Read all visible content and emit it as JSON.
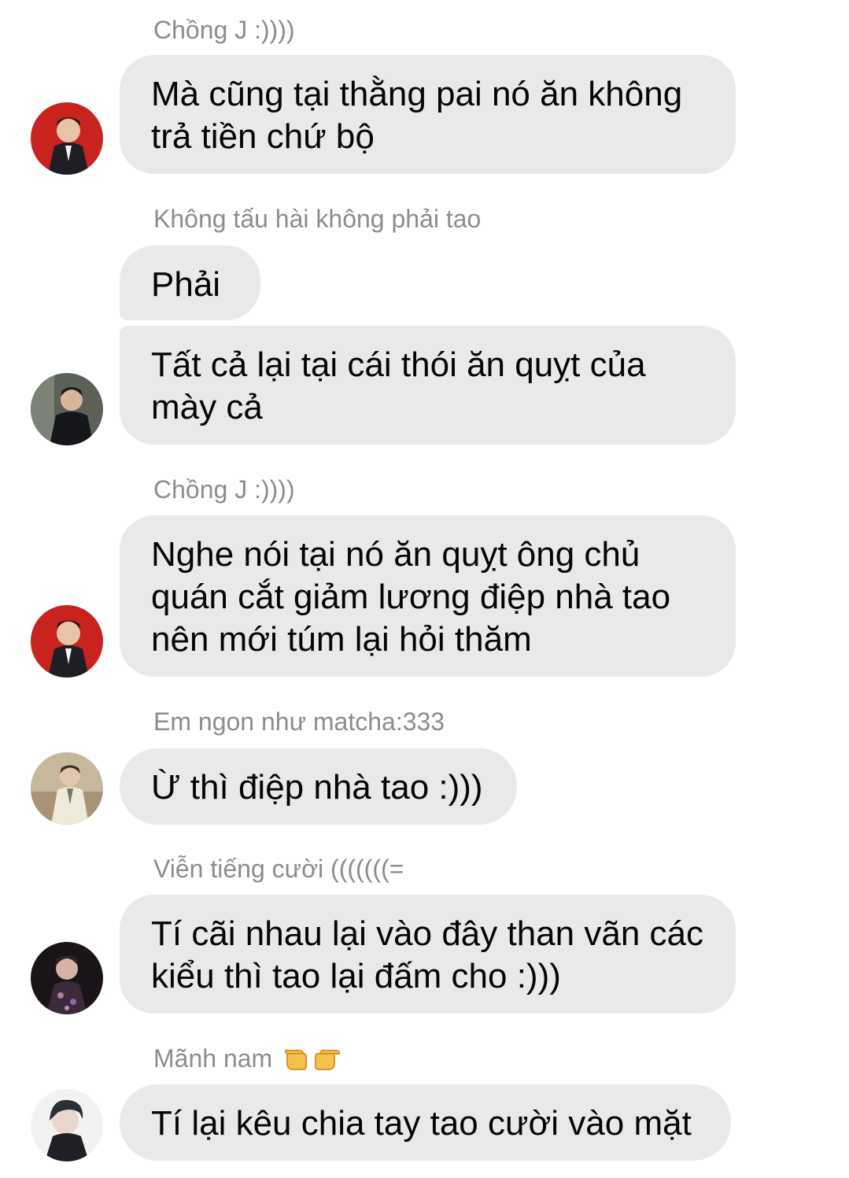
{
  "messages": [
    {
      "sender": "Chồng J :))))",
      "text": "Mà cũng tại thằng pai nó ăn không trả tiền chứ bộ"
    },
    {
      "sender": "Không tấu hài không phải tao",
      "text_1": "Phải",
      "text_2": "Tất cả lại tại cái thói ăn quỵt của mày cả"
    },
    {
      "sender": "Chồng J :))))",
      "text": "Nghe nói tại nó ăn quỵt ông chủ quán cắt giảm lương điệp nhà tao nên mới túm lại hỏi thăm"
    },
    {
      "sender": "Em ngon như matcha:333",
      "text": "Ừ thì điệp nhà tao :)))"
    },
    {
      "sender": "Viễn tiếng cười (((((((=",
      "text": "Tí cãi nhau lại vào đây than vãn các kiểu thì tao lại đấm cho :)))"
    },
    {
      "sender": "Mãnh nam",
      "sender_icon": "pointing-hands-icon",
      "text": "Tí lại kêu chia tay tao cười vào mặt"
    }
  ],
  "colors": {
    "bubble": "#e9e9eb",
    "sender_name": "#8a8d91",
    "message_text": "#050505",
    "background": "#ffffff"
  }
}
